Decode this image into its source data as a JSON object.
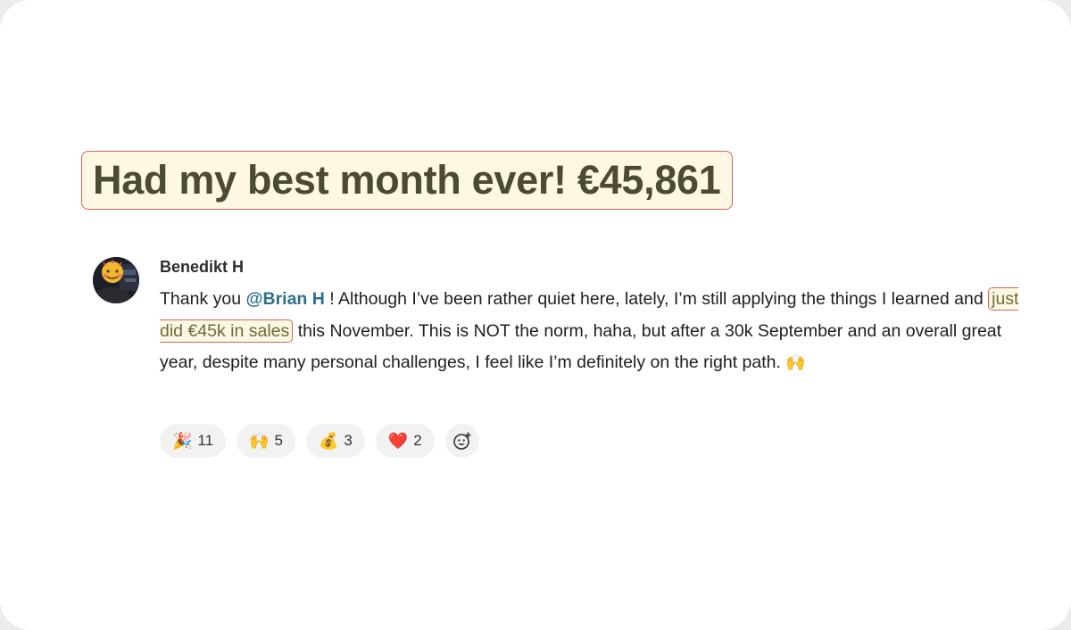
{
  "headline": {
    "text": "Had my best month ever! €45,861"
  },
  "post": {
    "author": "Benedikt H",
    "text_before_mention": "Thank you ",
    "mention": "@Brian H",
    "text_after_mention": " ! Although I’ve been rather quiet here, lately, I’m still applying the things I learned and",
    "highlight": "just did €45k in sales",
    "text_after_highlight": "this November. This is NOT the norm, haha, but after a 30k September and an overall great year, despite many personal challenges, I feel like I’m definitely on the right path.",
    "trailing_emoji": "🙌"
  },
  "reactions": [
    {
      "emoji": "🎉",
      "icon": "party-popper-icon",
      "count": "11"
    },
    {
      "emoji": "🙌",
      "icon": "raising-hands-icon",
      "count": "5"
    },
    {
      "emoji": "💰",
      "icon": "money-bag-icon",
      "count": "3"
    },
    {
      "emoji": "❤️",
      "icon": "red-heart-icon",
      "count": "2"
    }
  ],
  "add_reaction_icon": "add-emoji-icon",
  "colors": {
    "highlight_fill": "#fdf8e3",
    "highlight_border": "#e0605b",
    "mention": "#2e6f8e"
  }
}
